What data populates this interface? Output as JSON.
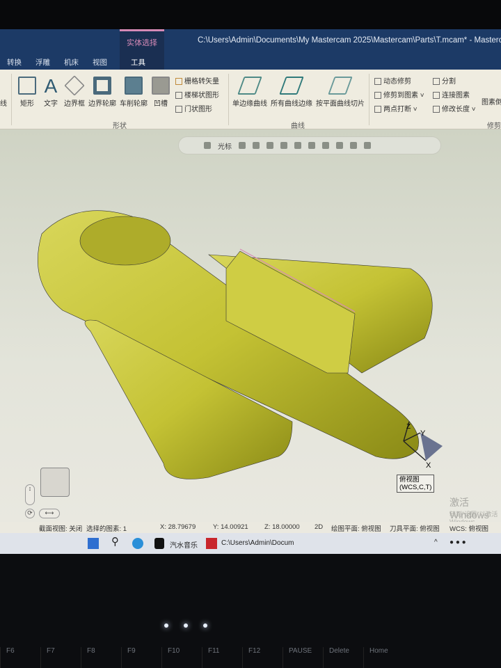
{
  "window": {
    "context_tab": "实体选择",
    "title": "C:\\Users\\Admin\\Documents\\My Mastercam 2025\\Mastercam\\Parts\\T.mcam* - Mastercam"
  },
  "tabs": [
    "转换",
    "浮雕",
    "机床",
    "视图",
    "工具"
  ],
  "ribbon": {
    "partial_left": "线",
    "shape_buttons": [
      "矩形",
      "文字",
      "边界框",
      "边界轮廓",
      "车削轮廓",
      "凹槽"
    ],
    "shape_small": [
      "栅格转矢量",
      "楼梯状图形",
      "门状图形"
    ],
    "shape_group": "形状",
    "curve_buttons": [
      "单边缘曲线",
      "所有曲线边缘",
      "按平面曲线切片"
    ],
    "curve_group": "曲线",
    "trim_small": [
      "动态修剪",
      "修剪到图素",
      "两点打断",
      "分割",
      "连接图素",
      "修改长度"
    ],
    "trim_partial": "图素倒",
    "trim_group": "修剪"
  },
  "floating_toolbar": {
    "cursor_label": "光标"
  },
  "viewport": {
    "view_name": "俯视图",
    "view_sub": "(WCS,C,T)",
    "axis_x": "X",
    "axis_y": "Y",
    "axis_z": "Z",
    "watermark": "激活 Windows",
    "watermark_sub": "转到\"设置\"以激活 Windows"
  },
  "status": {
    "section_view": "截面视图: 关闭",
    "selected": "选择的图素: 1",
    "x": "X:  28.79679",
    "y": "Y:  14.00921",
    "z": "Z:  18.00000",
    "mode": "2D",
    "cplane": "绘图平面: 俯视图",
    "tplane": "刀具平面: 俯视图",
    "wcs": "WCS: 俯视图"
  },
  "taskbar": {
    "music": "汽水音乐",
    "mastercam": "C:\\Users\\Admin\\Docum"
  },
  "keyboard": [
    "F6",
    "F7",
    "F8",
    "F9",
    "F10",
    "F11",
    "F12",
    "PAUSE",
    "Delete",
    "Home"
  ],
  "colors": {
    "title": "#1c3a66",
    "ribbon": "#efece0",
    "model": "#c9c63a",
    "accent": "#d58ab6"
  }
}
